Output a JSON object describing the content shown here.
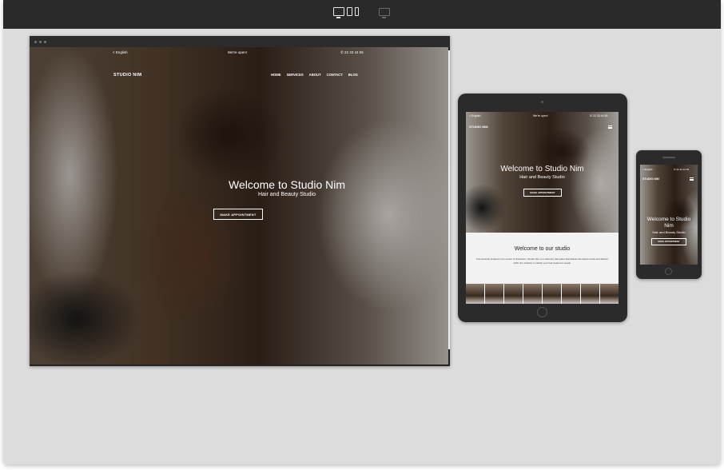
{
  "colors": {
    "toolbar": "#2a2a2a",
    "canvas": "#dcdcdc",
    "device": "#2b2b2b"
  },
  "toolbar": {
    "device_group_icon": "desktop-tablet-phone-icon",
    "fullscreen_icon": "monitor-icon"
  },
  "site": {
    "language": "< English",
    "open_status": "We're open!",
    "phone": "22 33 44 55",
    "brand": "STUDIO NIM",
    "nav": [
      "HOME",
      "SERVICES",
      "ABOUT",
      "CONTACT",
      "BLOG"
    ],
    "hero_title": "Welcome to Studio Nim",
    "hero_subtitle": "Hair and Beauty Studio",
    "cta": "MAKE APPOINTMENT",
    "welcome_heading": "Welcome to our studio",
    "welcome_text": "Conveniently located in the center of downtown, Studio Nim is a visionary hair salon that follows the latest trends and fashion within the industry to satisfy your hair treatment needs."
  }
}
